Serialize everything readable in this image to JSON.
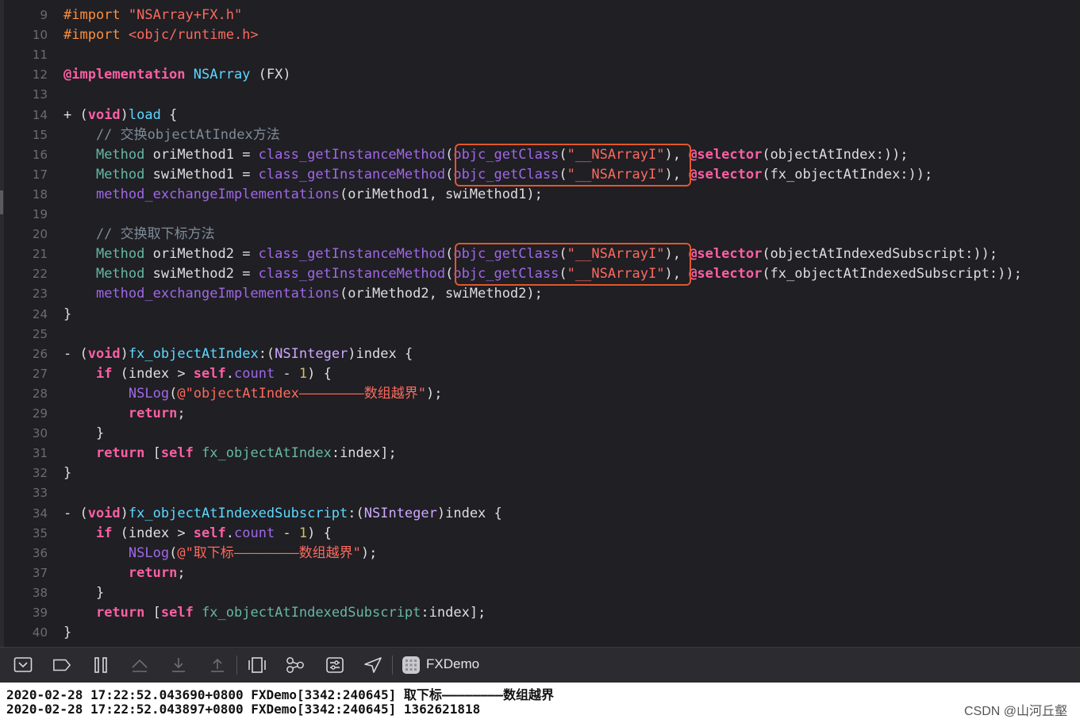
{
  "editor": {
    "lines": [
      {
        "n": "9",
        "segs": [
          {
            "t": "#import ",
            "c": "pre"
          },
          {
            "t": "\"NSArray+FX.h\"",
            "c": "str"
          }
        ]
      },
      {
        "n": "10",
        "segs": [
          {
            "t": "#import ",
            "c": "pre"
          },
          {
            "t": "<objc/runtime.h>",
            "c": "str"
          }
        ]
      },
      {
        "n": "11",
        "segs": []
      },
      {
        "n": "12",
        "segs": [
          {
            "t": "@implementation ",
            "c": "kw"
          },
          {
            "t": "NSArray",
            "c": "cls"
          },
          {
            "t": " (FX)",
            "c": "plain"
          }
        ]
      },
      {
        "n": "13",
        "segs": []
      },
      {
        "n": "14",
        "segs": [
          {
            "t": "+ (",
            "c": "plain"
          },
          {
            "t": "void",
            "c": "kw"
          },
          {
            "t": ")",
            "c": "plain"
          },
          {
            "t": "load",
            "c": "cls"
          },
          {
            "t": " {",
            "c": "plain"
          }
        ]
      },
      {
        "n": "15",
        "segs": [
          {
            "t": "    // 交换objectAtIndex方法",
            "c": "cmt"
          }
        ]
      },
      {
        "n": "16",
        "segs": [
          {
            "t": "    ",
            "c": "plain"
          },
          {
            "t": "Method",
            "c": "proj"
          },
          {
            "t": " oriMethod1 = ",
            "c": "plain"
          },
          {
            "t": "class_getInstanceMethod",
            "c": "fn"
          },
          {
            "t": "(",
            "c": "plain"
          },
          {
            "t": "objc_getClass",
            "c": "fn"
          },
          {
            "t": "(",
            "c": "plain"
          },
          {
            "t": "\"__NSArrayI\"",
            "c": "str"
          },
          {
            "t": "), ",
            "c": "plain"
          },
          {
            "t": "@selector",
            "c": "kw"
          },
          {
            "t": "(objectAtIndex:));",
            "c": "plain"
          }
        ]
      },
      {
        "n": "17",
        "segs": [
          {
            "t": "    ",
            "c": "plain"
          },
          {
            "t": "Method",
            "c": "proj"
          },
          {
            "t": " swiMethod1 = ",
            "c": "plain"
          },
          {
            "t": "class_getInstanceMethod",
            "c": "fn"
          },
          {
            "t": "(",
            "c": "plain"
          },
          {
            "t": "objc_getClass",
            "c": "fn"
          },
          {
            "t": "(",
            "c": "plain"
          },
          {
            "t": "\"__NSArrayI\"",
            "c": "str"
          },
          {
            "t": "), ",
            "c": "plain"
          },
          {
            "t": "@selector",
            "c": "kw"
          },
          {
            "t": "(fx_objectAtIndex:));",
            "c": "plain"
          }
        ]
      },
      {
        "n": "18",
        "segs": [
          {
            "t": "    ",
            "c": "plain"
          },
          {
            "t": "method_exchangeImplementations",
            "c": "fn"
          },
          {
            "t": "(oriMethod1, swiMethod1);",
            "c": "plain"
          }
        ]
      },
      {
        "n": "19",
        "segs": []
      },
      {
        "n": "20",
        "segs": [
          {
            "t": "    // 交换取下标方法",
            "c": "cmt"
          }
        ]
      },
      {
        "n": "21",
        "segs": [
          {
            "t": "    ",
            "c": "plain"
          },
          {
            "t": "Method",
            "c": "proj"
          },
          {
            "t": " oriMethod2 = ",
            "c": "plain"
          },
          {
            "t": "class_getInstanceMethod",
            "c": "fn"
          },
          {
            "t": "(",
            "c": "plain"
          },
          {
            "t": "objc_getClass",
            "c": "fn"
          },
          {
            "t": "(",
            "c": "plain"
          },
          {
            "t": "\"__NSArrayI\"",
            "c": "str"
          },
          {
            "t": "), ",
            "c": "plain"
          },
          {
            "t": "@selector",
            "c": "kw"
          },
          {
            "t": "(objectAtIndexedSubscript:));",
            "c": "plain"
          }
        ]
      },
      {
        "n": "22",
        "segs": [
          {
            "t": "    ",
            "c": "plain"
          },
          {
            "t": "Method",
            "c": "proj"
          },
          {
            "t": " swiMethod2 = ",
            "c": "plain"
          },
          {
            "t": "class_getInstanceMethod",
            "c": "fn"
          },
          {
            "t": "(",
            "c": "plain"
          },
          {
            "t": "objc_getClass",
            "c": "fn"
          },
          {
            "t": "(",
            "c": "plain"
          },
          {
            "t": "\"__NSArrayI\"",
            "c": "str"
          },
          {
            "t": "), ",
            "c": "plain"
          },
          {
            "t": "@selector",
            "c": "kw"
          },
          {
            "t": "(fx_objectAtIndexedSubscript:));",
            "c": "plain"
          }
        ]
      },
      {
        "n": "23",
        "segs": [
          {
            "t": "    ",
            "c": "plain"
          },
          {
            "t": "method_exchangeImplementations",
            "c": "fn"
          },
          {
            "t": "(oriMethod2, swiMethod2);",
            "c": "plain"
          }
        ]
      },
      {
        "n": "24",
        "segs": [
          {
            "t": "}",
            "c": "plain"
          }
        ]
      },
      {
        "n": "25",
        "segs": []
      },
      {
        "n": "26",
        "segs": [
          {
            "t": "- (",
            "c": "plain"
          },
          {
            "t": "void",
            "c": "kw"
          },
          {
            "t": ")",
            "c": "plain"
          },
          {
            "t": "fx_objectAtIndex",
            "c": "cls"
          },
          {
            "t": ":(",
            "c": "plain"
          },
          {
            "t": "NSInteger",
            "c": "type"
          },
          {
            "t": ")index {",
            "c": "plain"
          }
        ]
      },
      {
        "n": "27",
        "segs": [
          {
            "t": "    ",
            "c": "plain"
          },
          {
            "t": "if",
            "c": "kw"
          },
          {
            "t": " (index > ",
            "c": "plain"
          },
          {
            "t": "self",
            "c": "kw"
          },
          {
            "t": ".",
            "c": "plain"
          },
          {
            "t": "count",
            "c": "fn"
          },
          {
            "t": " - ",
            "c": "plain"
          },
          {
            "t": "1",
            "c": "num"
          },
          {
            "t": ") {",
            "c": "plain"
          }
        ]
      },
      {
        "n": "28",
        "segs": [
          {
            "t": "        ",
            "c": "plain"
          },
          {
            "t": "NSLog",
            "c": "fn"
          },
          {
            "t": "(",
            "c": "plain"
          },
          {
            "t": "@\"objectAtIndex————————数组越界\"",
            "c": "str"
          },
          {
            "t": ");",
            "c": "plain"
          }
        ]
      },
      {
        "n": "29",
        "segs": [
          {
            "t": "        ",
            "c": "plain"
          },
          {
            "t": "return",
            "c": "kw"
          },
          {
            "t": ";",
            "c": "plain"
          }
        ]
      },
      {
        "n": "30",
        "segs": [
          {
            "t": "    }",
            "c": "plain"
          }
        ]
      },
      {
        "n": "31",
        "segs": [
          {
            "t": "    ",
            "c": "plain"
          },
          {
            "t": "return",
            "c": "kw"
          },
          {
            "t": " [",
            "c": "plain"
          },
          {
            "t": "self",
            "c": "kw"
          },
          {
            "t": " ",
            "c": "plain"
          },
          {
            "t": "fx_objectAtIndex",
            "c": "proj"
          },
          {
            "t": ":index];",
            "c": "plain"
          }
        ]
      },
      {
        "n": "32",
        "segs": [
          {
            "t": "}",
            "c": "plain"
          }
        ]
      },
      {
        "n": "33",
        "segs": []
      },
      {
        "n": "34",
        "segs": [
          {
            "t": "- (",
            "c": "plain"
          },
          {
            "t": "void",
            "c": "kw"
          },
          {
            "t": ")",
            "c": "plain"
          },
          {
            "t": "fx_objectAtIndexedSubscript",
            "c": "cls"
          },
          {
            "t": ":(",
            "c": "plain"
          },
          {
            "t": "NSInteger",
            "c": "type"
          },
          {
            "t": ")index {",
            "c": "plain"
          }
        ]
      },
      {
        "n": "35",
        "segs": [
          {
            "t": "    ",
            "c": "plain"
          },
          {
            "t": "if",
            "c": "kw"
          },
          {
            "t": " (index > ",
            "c": "plain"
          },
          {
            "t": "self",
            "c": "kw"
          },
          {
            "t": ".",
            "c": "plain"
          },
          {
            "t": "count",
            "c": "fn"
          },
          {
            "t": " - ",
            "c": "plain"
          },
          {
            "t": "1",
            "c": "num"
          },
          {
            "t": ") {",
            "c": "plain"
          }
        ]
      },
      {
        "n": "36",
        "segs": [
          {
            "t": "        ",
            "c": "plain"
          },
          {
            "t": "NSLog",
            "c": "fn"
          },
          {
            "t": "(",
            "c": "plain"
          },
          {
            "t": "@\"取下标————————数组越界\"",
            "c": "str"
          },
          {
            "t": ");",
            "c": "plain"
          }
        ]
      },
      {
        "n": "37",
        "segs": [
          {
            "t": "        ",
            "c": "plain"
          },
          {
            "t": "return",
            "c": "kw"
          },
          {
            "t": ";",
            "c": "plain"
          }
        ]
      },
      {
        "n": "38",
        "segs": [
          {
            "t": "    }",
            "c": "plain"
          }
        ]
      },
      {
        "n": "39",
        "segs": [
          {
            "t": "    ",
            "c": "plain"
          },
          {
            "t": "return",
            "c": "kw"
          },
          {
            "t": " [",
            "c": "plain"
          },
          {
            "t": "self",
            "c": "kw"
          },
          {
            "t": " ",
            "c": "plain"
          },
          {
            "t": "fx_objectAtIndexedSubscript",
            "c": "proj"
          },
          {
            "t": ":index];",
            "c": "plain"
          }
        ]
      },
      {
        "n": "40",
        "segs": [
          {
            "t": "}",
            "c": "plain"
          }
        ]
      }
    ],
    "highlight_color": "#e2572b"
  },
  "toolbar": {
    "icons": [
      "hide-console-icon",
      "breakpoints-icon",
      "pause-icon",
      "step-over-icon",
      "step-into-icon",
      "step-out-icon",
      "view-debugger-icon",
      "memory-graph-icon",
      "environment-overrides-icon",
      "location-icon"
    ],
    "scheme_label": "FXDemo"
  },
  "console": {
    "lines": [
      "2020-02-28 17:22:52.043690+0800 FXDemo[3342:240645] 取下标————————数组越界",
      "2020-02-28 17:22:52.043897+0800 FXDemo[3342:240645] 1362621818"
    ],
    "watermark": "CSDN @山河丘壑"
  }
}
